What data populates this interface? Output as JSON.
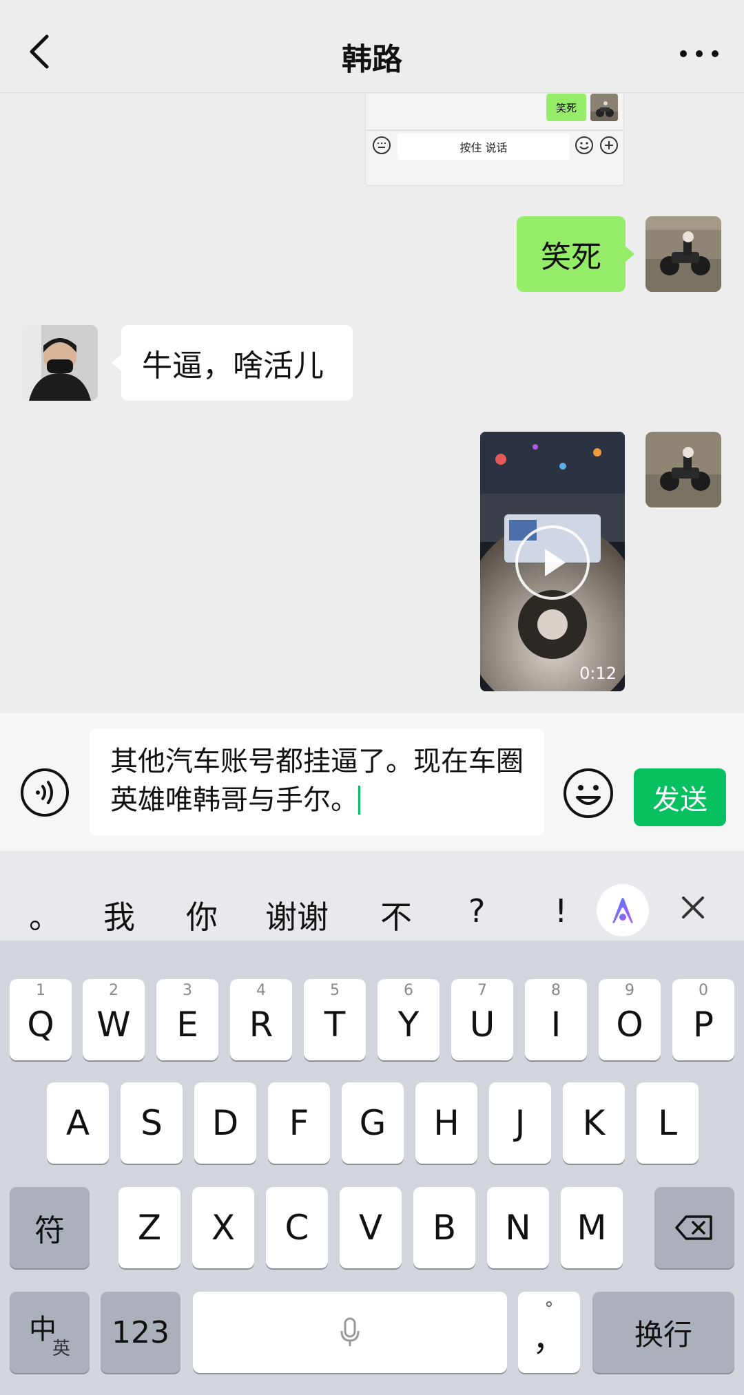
{
  "header": {
    "title": "韩路"
  },
  "nested_shot": {
    "bubble_text": "笑死",
    "input_text": "按住 说话"
  },
  "messages": [
    {
      "side": "right",
      "text": "笑死"
    },
    {
      "side": "left",
      "text": "牛逼，啥活儿"
    },
    {
      "side": "right",
      "type": "video",
      "duration": "0:12"
    }
  ],
  "input": {
    "text": "其他汽车账号都挂逼了。现在车圈英雄唯韩哥与手尔。",
    "send_label": "发送"
  },
  "keyboard": {
    "suggestions": [
      "。",
      "我",
      "你",
      "谢谢",
      "不",
      "?",
      "!"
    ],
    "row1": [
      "Q",
      "W",
      "E",
      "R",
      "T",
      "Y",
      "U",
      "I",
      "O",
      "P"
    ],
    "row1_nums": [
      "1",
      "2",
      "3",
      "4",
      "5",
      "6",
      "7",
      "8",
      "9",
      "0"
    ],
    "row2": [
      "A",
      "S",
      "D",
      "F",
      "G",
      "H",
      "J",
      "K",
      "L"
    ],
    "row3": [
      "Z",
      "X",
      "C",
      "V",
      "B",
      "N",
      "M"
    ],
    "symbol_label": "符",
    "lang_main": "中",
    "lang_sub": "英",
    "num_label": "123",
    "punct_top": "°",
    "punct_label": "，",
    "return_label": "换行"
  },
  "colors": {
    "accent": "#07c160",
    "bubble_green": "#95ec69",
    "background": "#ededed"
  }
}
